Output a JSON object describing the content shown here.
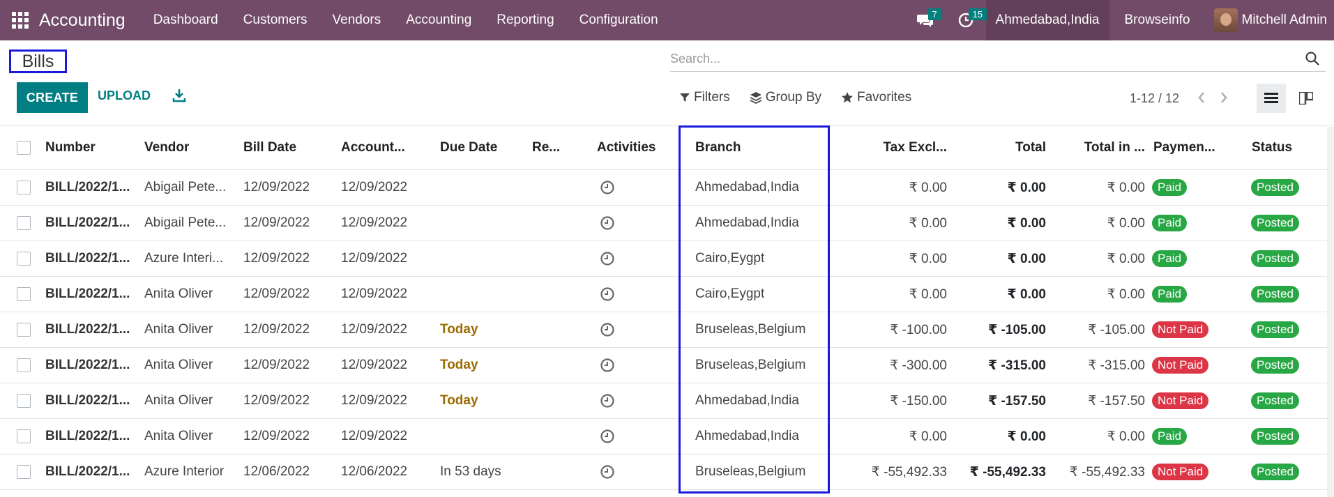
{
  "navbar": {
    "app_name": "Accounting",
    "menu": [
      "Dashboard",
      "Customers",
      "Vendors",
      "Accounting",
      "Reporting",
      "Configuration"
    ],
    "messages_count": "7",
    "activities_count": "15",
    "active_company": "Ahmedabad,India",
    "company": "Browseinfo",
    "user_name": "Mitchell Admin",
    "bar_color": "#714b67"
  },
  "control": {
    "title": "Bills",
    "search_placeholder": "Search...",
    "create_label": "CREATE",
    "upload_label": "UPLOAD",
    "filters_label": "Filters",
    "groupby_label": "Group By",
    "favorites_label": "Favorites",
    "pager": "1-12 / 12"
  },
  "table": {
    "headers": [
      "Number",
      "Vendor",
      "Bill Date",
      "Account...",
      "Due Date",
      "Re...",
      "Activities",
      "Branch",
      "Tax Excl...",
      "Total",
      "Total in ...",
      "Paymen...",
      "Status"
    ],
    "rows": [
      {
        "number": "BILL/2022/1...",
        "vendor": "Abigail Pete...",
        "bill_date": "12/09/2022",
        "account_date": "12/09/2022",
        "due": "",
        "branch": "Ahmedabad,India",
        "tax_excl": "₹ 0.00",
        "total": "₹ 0.00",
        "total_cur": "₹ 0.00",
        "payment": "Paid",
        "status": "Posted"
      },
      {
        "number": "BILL/2022/1...",
        "vendor": "Abigail Pete...",
        "bill_date": "12/09/2022",
        "account_date": "12/09/2022",
        "due": "",
        "branch": "Ahmedabad,India",
        "tax_excl": "₹ 0.00",
        "total": "₹ 0.00",
        "total_cur": "₹ 0.00",
        "payment": "Paid",
        "status": "Posted"
      },
      {
        "number": "BILL/2022/1...",
        "vendor": "Azure Interi...",
        "bill_date": "12/09/2022",
        "account_date": "12/09/2022",
        "due": "",
        "branch": "Cairo,Eygpt",
        "tax_excl": "₹ 0.00",
        "total": "₹ 0.00",
        "total_cur": "₹ 0.00",
        "payment": "Paid",
        "status": "Posted"
      },
      {
        "number": "BILL/2022/1...",
        "vendor": "Anita Oliver",
        "bill_date": "12/09/2022",
        "account_date": "12/09/2022",
        "due": "",
        "branch": "Cairo,Eygpt",
        "tax_excl": "₹ 0.00",
        "total": "₹ 0.00",
        "total_cur": "₹ 0.00",
        "payment": "Paid",
        "status": "Posted"
      },
      {
        "number": "BILL/2022/1...",
        "vendor": "Anita Oliver",
        "bill_date": "12/09/2022",
        "account_date": "12/09/2022",
        "due": "Today",
        "branch": "Bruseleas,Belgium",
        "tax_excl": "₹ -100.00",
        "total": "₹ -105.00",
        "total_cur": "₹ -105.00",
        "payment": "Not Paid",
        "status": "Posted"
      },
      {
        "number": "BILL/2022/1...",
        "vendor": "Anita Oliver",
        "bill_date": "12/09/2022",
        "account_date": "12/09/2022",
        "due": "Today",
        "branch": "Bruseleas,Belgium",
        "tax_excl": "₹ -300.00",
        "total": "₹ -315.00",
        "total_cur": "₹ -315.00",
        "payment": "Not Paid",
        "status": "Posted"
      },
      {
        "number": "BILL/2022/1...",
        "vendor": "Anita Oliver",
        "bill_date": "12/09/2022",
        "account_date": "12/09/2022",
        "due": "Today",
        "branch": "Ahmedabad,India",
        "tax_excl": "₹ -150.00",
        "total": "₹ -157.50",
        "total_cur": "₹ -157.50",
        "payment": "Not Paid",
        "status": "Posted"
      },
      {
        "number": "BILL/2022/1...",
        "vendor": "Anita Oliver",
        "bill_date": "12/09/2022",
        "account_date": "12/09/2022",
        "due": "",
        "branch": "Ahmedabad,India",
        "tax_excl": "₹ 0.00",
        "total": "₹ 0.00",
        "total_cur": "₹ 0.00",
        "payment": "Paid",
        "status": "Posted"
      },
      {
        "number": "BILL/2022/1...",
        "vendor": "Azure Interior",
        "bill_date": "12/06/2022",
        "account_date": "12/06/2022",
        "due": "In 53 days",
        "branch": "Bruseleas,Belgium",
        "tax_excl": "₹ -55,492.33",
        "total": "₹ -55,492.33",
        "total_cur": "₹ -55,492.33",
        "payment": "Not Paid",
        "status": "Posted"
      }
    ]
  }
}
